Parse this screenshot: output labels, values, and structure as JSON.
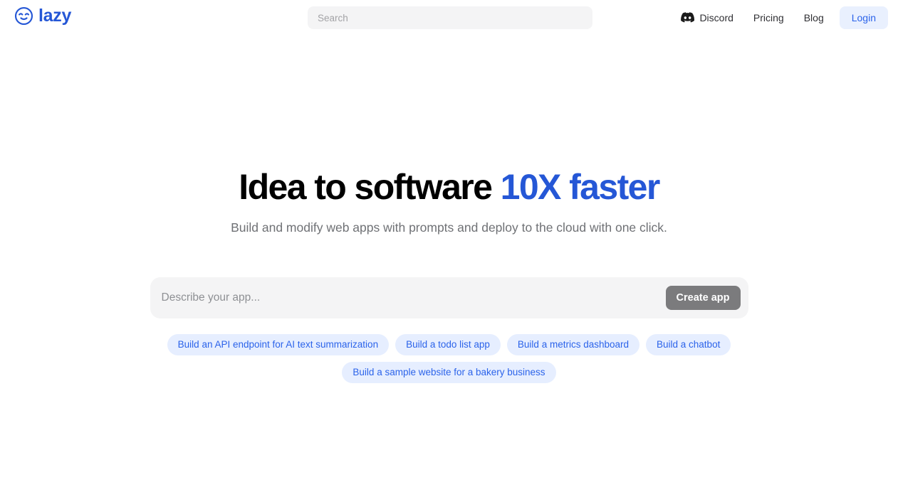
{
  "header": {
    "brand": {
      "name": "lazy",
      "icon": "sleepy-face-logo-icon",
      "color": "#2557d6"
    },
    "search": {
      "placeholder": "Search",
      "value": ""
    },
    "nav_links": [
      {
        "label": "Discord",
        "icon": "discord-icon"
      },
      {
        "label": "Pricing",
        "icon": ""
      },
      {
        "label": "Blog",
        "icon": ""
      }
    ],
    "login_label": "Login"
  },
  "hero": {
    "headline_plain": "Idea to software ",
    "headline_accent": "10X faster",
    "subhead": "Build and modify web apps with prompts and deploy to the cloud with one click.",
    "accent_color": "#2557d6"
  },
  "prompt": {
    "placeholder": "Describe your app...",
    "value": "",
    "submit_label": "Create app",
    "submit_color": "#7b7b7d"
  },
  "suggestions": {
    "chip_bg": "#e6eeff",
    "chip_color": "#2b63ea",
    "items": [
      {
        "label": "Build an API endpoint for AI text summarization"
      },
      {
        "label": "Build a todo list app"
      },
      {
        "label": "Build a metrics dashboard"
      },
      {
        "label": "Build a chatbot"
      },
      {
        "label": "Build a sample website for a bakery business"
      }
    ]
  }
}
